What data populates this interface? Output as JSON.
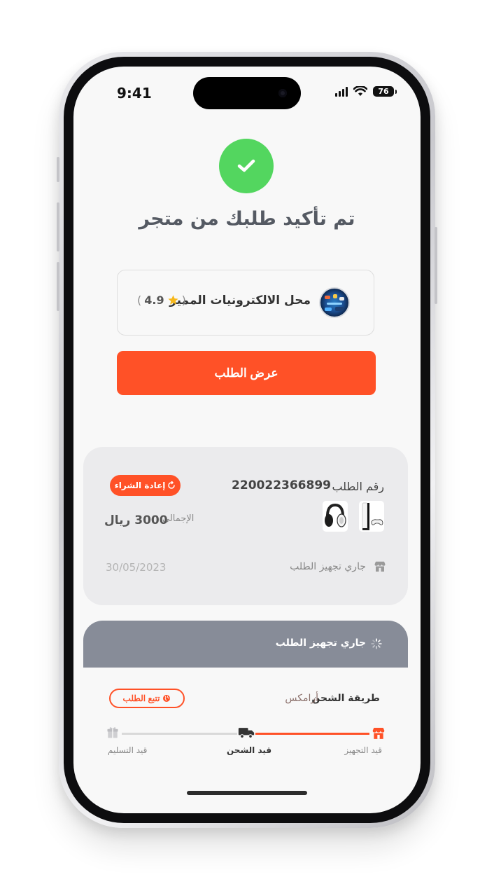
{
  "status_bar": {
    "time": "9:41",
    "battery": "76"
  },
  "confirmation": {
    "title": "تم تأكيد طلبك من متجر"
  },
  "store": {
    "name": "محل الالكترونيات المميز",
    "rating": "4.9"
  },
  "actions": {
    "view_order": "عرض الطلب"
  },
  "order": {
    "number_label": "رقم الطلب",
    "number": "220022366899",
    "rebuy_label": "إعادة الشراء",
    "total_label": "الإجمالي",
    "total_value": "3000 ريال",
    "status": "جاري تجهيز الطلب",
    "date": "30/05/2023"
  },
  "processing": {
    "text": "جاري تجهيز الطلب"
  },
  "shipping": {
    "method_label": "طريقة الشحن",
    "method_value": "أرامكس",
    "track_label": "تتبع الطلب",
    "steps": [
      {
        "label": "قيد التجهيز",
        "icon": "store-icon",
        "state": "done"
      },
      {
        "label": "قيد الشحن",
        "icon": "truck-icon",
        "state": "active"
      },
      {
        "label": "قيد التسليم",
        "icon": "package-icon",
        "state": "pending"
      }
    ],
    "progress": 0.5
  },
  "colors": {
    "accent": "#ff5127",
    "success": "#53d65f",
    "header_gray": "#878c98"
  }
}
